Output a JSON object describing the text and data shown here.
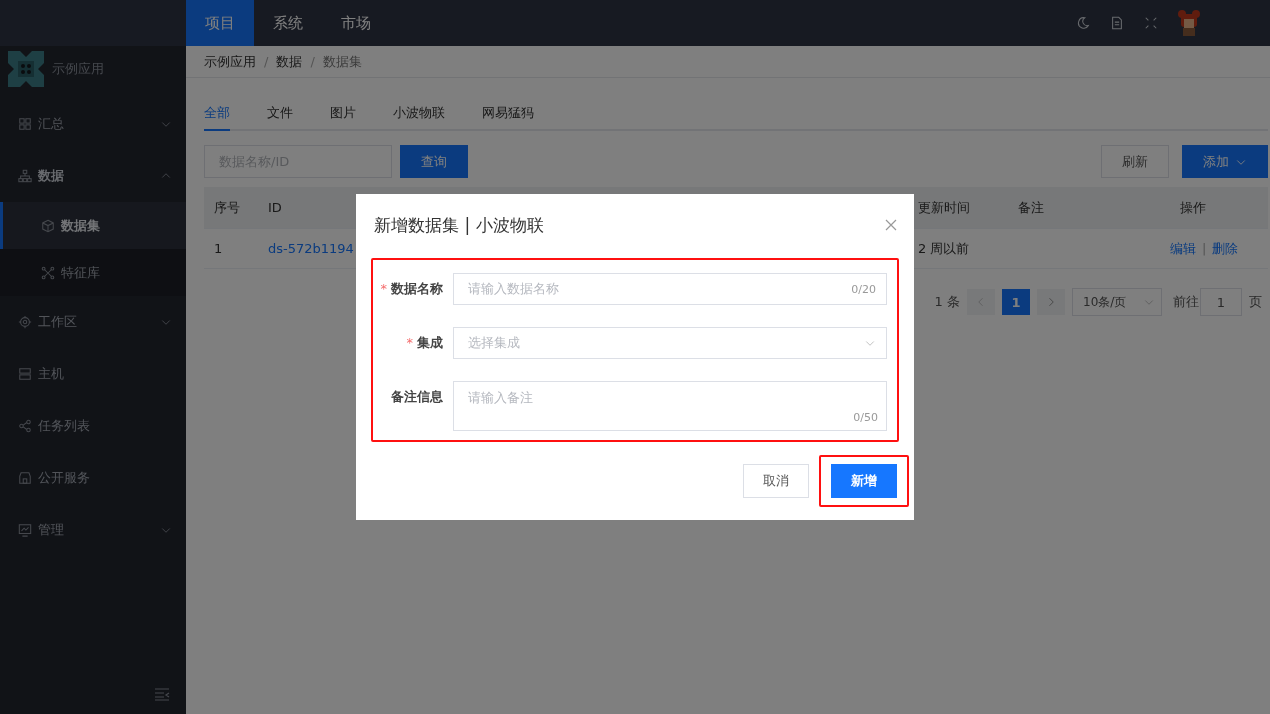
{
  "topnav": [
    {
      "label": "项目",
      "selected": true
    },
    {
      "label": "系统",
      "selected": false
    },
    {
      "label": "市场",
      "selected": false
    }
  ],
  "app_name": "示例应用",
  "sidebar": {
    "items": [
      {
        "label": "汇总",
        "kind": "group",
        "expanded": false
      },
      {
        "label": "数据",
        "kind": "group",
        "expanded": true,
        "children": [
          {
            "label": "数据集",
            "selected": true
          },
          {
            "label": "特征库",
            "selected": false
          }
        ]
      },
      {
        "label": "工作区",
        "kind": "group",
        "expanded": false
      },
      {
        "label": "主机",
        "kind": "link"
      },
      {
        "label": "任务列表",
        "kind": "link"
      },
      {
        "label": "公开服务",
        "kind": "link"
      },
      {
        "label": "管理",
        "kind": "group",
        "expanded": false
      }
    ]
  },
  "breadcrumb": [
    "示例应用",
    "数据",
    "数据集"
  ],
  "breadcrumb_separators": [
    "/",
    "/"
  ],
  "tabs": [
    {
      "label": "全部",
      "selected": true
    },
    {
      "label": "文件",
      "selected": false
    },
    {
      "label": "图片",
      "selected": false
    },
    {
      "label": "小波物联",
      "selected": false
    },
    {
      "label": "网易猛犸",
      "selected": false
    }
  ],
  "search": {
    "placeholder": "数据名称/ID",
    "button": "查询"
  },
  "toolbar": {
    "refresh": "刷新",
    "add": "添加"
  },
  "table": {
    "columns": [
      "序号",
      "ID",
      "更新时间",
      "备注",
      "操作"
    ],
    "rows": [
      {
        "cells": [
          "1",
          "ds-572b1194",
          "2 周以前",
          ""
        ],
        "actions": [
          "编辑",
          "删除"
        ],
        "action_separators": [
          "|"
        ]
      }
    ]
  },
  "pagination": {
    "total": "1 条",
    "pages": [
      {
        "label": "1",
        "selected": true
      }
    ],
    "page_size": "10条/页",
    "goto_label": "前往",
    "goto_value": "1",
    "goto_suffix": "页"
  },
  "modal": {
    "title": "新增数据集 | 小波物联",
    "form_highlighted": true,
    "fields": [
      {
        "kind": "text",
        "label": "数据名称",
        "required": true,
        "required_mark": "*",
        "placeholder": "请输入数据名称",
        "counter": "0/20"
      },
      {
        "kind": "select",
        "label": "集成",
        "required": true,
        "required_mark": "*",
        "placeholder": "选择集成"
      },
      {
        "kind": "textarea",
        "label": "备注信息",
        "placeholder": "请输入备注",
        "counter": "0/50"
      }
    ],
    "buttons": [
      {
        "label": "取消",
        "kind": "default",
        "highlighted": false
      },
      {
        "label": "新增",
        "kind": "primary",
        "highlighted": true
      }
    ]
  }
}
